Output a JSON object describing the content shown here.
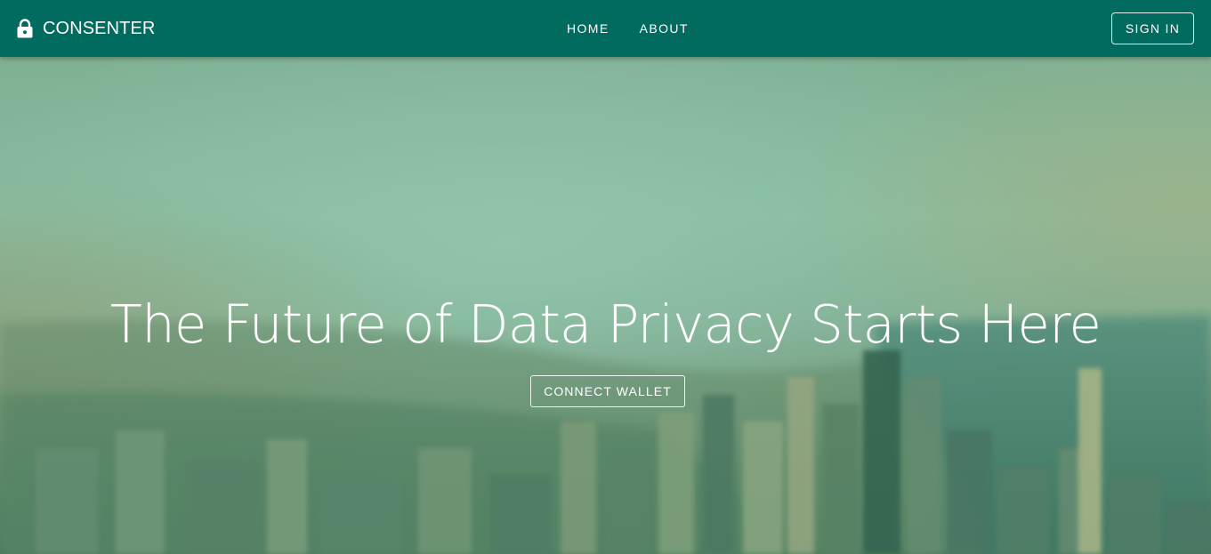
{
  "header": {
    "brand_icon": "lock-icon",
    "brand_name": "CONSENTER",
    "nav": [
      {
        "label": "HOME"
      },
      {
        "label": "ABOUT"
      }
    ],
    "sign_in_label": "SIGN IN",
    "bar_color": "#006b5e"
  },
  "hero": {
    "background": "blurred aerial city skyline with green tint",
    "title": "The Future of Data Privacy Starts Here",
    "cta_label": "CONNECT WALLET"
  }
}
